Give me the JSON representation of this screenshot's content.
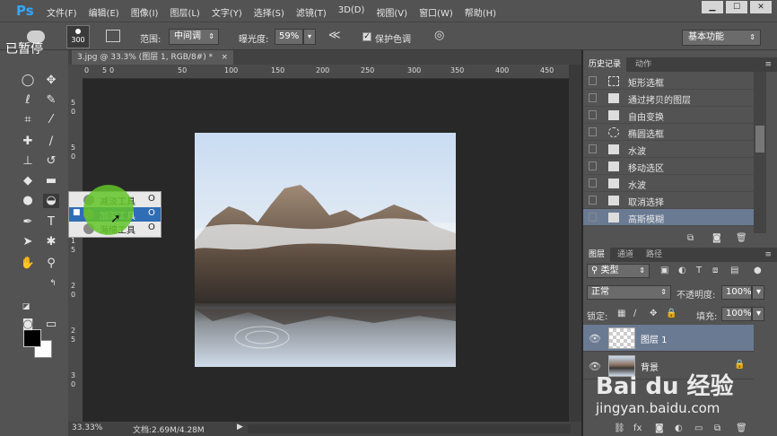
{
  "app": {
    "logo": "Ps"
  },
  "menu": [
    "文件(F)",
    "编辑(E)",
    "图像(I)",
    "图层(L)",
    "文字(Y)",
    "选择(S)",
    "滤镜(T)",
    "3D(D)",
    "视图(V)",
    "窗口(W)",
    "帮助(H)"
  ],
  "window_buttons": {
    "minimize": "▁",
    "maximize": "☐",
    "close": "✕"
  },
  "paused_label": "已暂停",
  "options": {
    "brush_size": "300",
    "range_label": "范围:",
    "range_value": "中间调",
    "exposure_label": "曝光度:",
    "exposure_value": "59%",
    "protect_tones_label": "保护色调",
    "protect_tones_checked": true,
    "workspace": "基本功能"
  },
  "document": {
    "tab_title": "3.jpg @ 33.3% (图层 1, RGB/8#) *",
    "zoom": "33.33%",
    "doc_size": "文档:2.69M/4.28M"
  },
  "ruler_top": [
    "0",
    "5",
    "0",
    "50",
    "100",
    "150",
    "200",
    "250",
    "300",
    "350",
    "400",
    "450",
    "500",
    "550"
  ],
  "ruler_left": [
    "5",
    "0",
    "5",
    "0",
    "1",
    "0",
    "1",
    "5",
    "2",
    "0",
    "2",
    "5",
    "3",
    "0",
    "3",
    "5"
  ],
  "tool_flyout": {
    "items": [
      {
        "label": "减淡工具",
        "key": "O",
        "selected": false
      },
      {
        "label": "加深工具",
        "key": "O",
        "selected": true
      },
      {
        "label": "海绵工具",
        "key": "O",
        "selected": false
      }
    ],
    "bullet": "■"
  },
  "history": {
    "tabs": [
      "历史记录",
      "动作"
    ],
    "items": [
      {
        "label": "矩形选框",
        "icon": "marquee-icon"
      },
      {
        "label": "通过拷贝的图层",
        "icon": "doc-icon"
      },
      {
        "label": "自由变换",
        "icon": "doc-icon"
      },
      {
        "label": "椭圆选框",
        "icon": "ellipse-icon"
      },
      {
        "label": "水波",
        "icon": "doc-icon"
      },
      {
        "label": "移动选区",
        "icon": "doc-icon"
      },
      {
        "label": "水波",
        "icon": "doc-icon"
      },
      {
        "label": "取消选择",
        "icon": "doc-icon"
      },
      {
        "label": "高斯模糊",
        "icon": "doc-icon",
        "selected": true
      }
    ]
  },
  "layers": {
    "tabs": [
      "图层",
      "通道",
      "路径"
    ],
    "filter_kind": "类型",
    "blend_mode": "正常",
    "opacity_label": "不透明度:",
    "opacity_value": "100%",
    "lock_label": "锁定:",
    "fill_label": "填充:",
    "fill_value": "100%",
    "items": [
      {
        "name": "图层 1",
        "selected": true
      },
      {
        "name": "背景",
        "selected": false,
        "locked": true
      }
    ]
  },
  "watermark": {
    "brand": "Bai du 经验",
    "url": "jingyan.baidu.com"
  },
  "colors": {
    "accent_blue": "#2f6db5",
    "ps_blue": "#31a8ff",
    "selection": "#6a7a93",
    "green_highlight": "#62c428"
  }
}
